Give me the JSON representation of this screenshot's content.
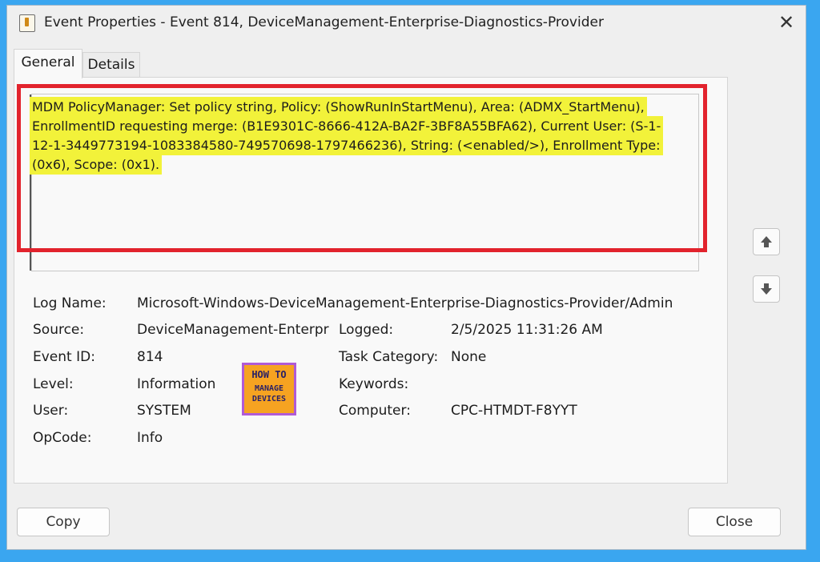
{
  "window": {
    "title": "Event Properties - Event 814, DeviceManagement-Enterprise-Diagnostics-Provider",
    "close_glyph": "✕"
  },
  "tabs": [
    {
      "label": "General",
      "active": true
    },
    {
      "label": "Details",
      "active": false
    }
  ],
  "description": {
    "lines": [
      "MDM PolicyManager: Set policy string, Policy: (ShowRunInStartMenu), Area: (ADMX_StartMenu),",
      "EnrollmentID requesting merge: (B1E9301C-8666-412A-BA2F-3BF8A55BFA62), Current User: (S-1-",
      "12-1-3449773194-1083384580-749570698-1797466236), String: (<enabled/>), Enrollment Type:",
      "(0x6), Scope: (0x1)."
    ],
    "highlight_color": "#f2f23a",
    "annotation_color": "#e2232d"
  },
  "scroll": {
    "up_icon": "up-arrow-icon",
    "down_icon": "down-arrow-icon"
  },
  "fields": {
    "log_name": {
      "label": "Log Name:",
      "value": "Microsoft-Windows-DeviceManagement-Enterprise-Diagnostics-Provider/Admin"
    },
    "source": {
      "label": "Source:",
      "value": "DeviceManagement-Enterpr"
    },
    "logged": {
      "label": "Logged:",
      "value": "2/5/2025 11:31:26 AM"
    },
    "event_id": {
      "label": "Event ID:",
      "value": "814"
    },
    "task_category": {
      "label": "Task Category:",
      "value": "None"
    },
    "level": {
      "label": "Level:",
      "value": "Information"
    },
    "keywords": {
      "label": "Keywords:",
      "value": ""
    },
    "user": {
      "label": "User:",
      "value": "SYSTEM"
    },
    "computer": {
      "label": "Computer:",
      "value": "CPC-HTMDT-F8YYT"
    },
    "opcode": {
      "label": "OpCode:",
      "value": "Info"
    }
  },
  "watermark": {
    "line1": "HOW TO",
    "line2": "MANAGE",
    "line3": "DEVICES"
  },
  "buttons": {
    "copy": "Copy",
    "close": "Close"
  }
}
